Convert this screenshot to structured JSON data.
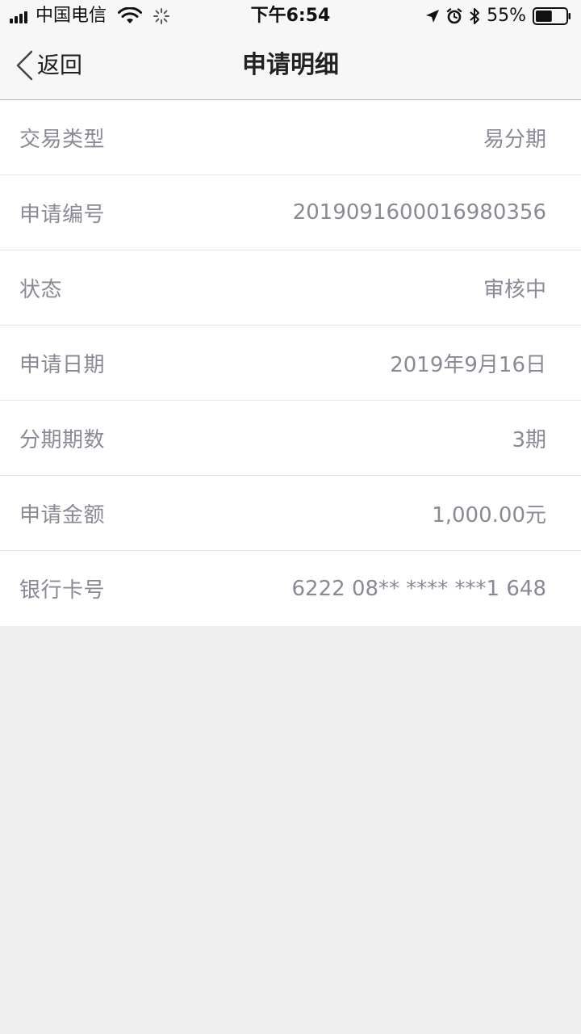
{
  "status_bar": {
    "carrier": "中国电信",
    "time": "下午6:54",
    "battery_percent": "55%",
    "battery_level": 0.55,
    "icons": [
      "signal-icon",
      "wifi-icon",
      "loading-icon",
      "location-icon",
      "alarm-icon",
      "bluetooth-icon",
      "battery-icon"
    ]
  },
  "nav": {
    "back_label": "返回",
    "title": "申请明细"
  },
  "details": [
    {
      "label": "交易类型",
      "value": "易分期"
    },
    {
      "label": "申请编号",
      "value": "2019091600016980356"
    },
    {
      "label": "状态",
      "value": "审核中"
    },
    {
      "label": "申请日期",
      "value": "2019年9月16日"
    },
    {
      "label": "分期期数",
      "value": "3期"
    },
    {
      "label": "申请金额",
      "value": "1,000.00元"
    },
    {
      "label": "银行卡号",
      "value": "6222 08** **** ***1 648"
    }
  ],
  "colors": {
    "background": "#efefef",
    "card": "#ffffff",
    "text_muted": "#8a8a96",
    "nav_bg": "#f7f7f7"
  }
}
